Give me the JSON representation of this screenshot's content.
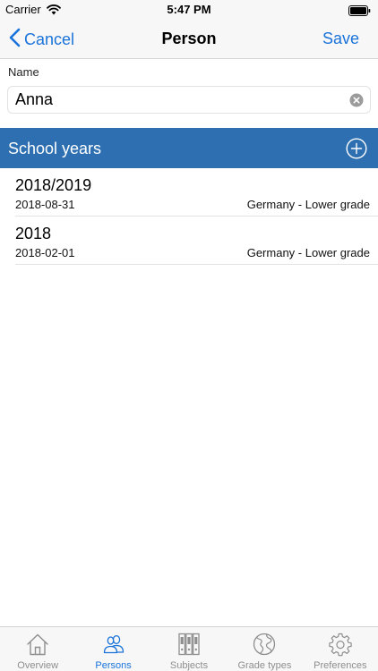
{
  "status_bar": {
    "carrier": "Carrier",
    "time": "5:47 PM"
  },
  "nav": {
    "back_label": "Cancel",
    "title": "Person",
    "save_label": "Save"
  },
  "form": {
    "name_label": "Name",
    "name_value": "Anna"
  },
  "section": {
    "title": "School years"
  },
  "school_years": [
    {
      "year": "2018/2019",
      "date": "2018-08-31",
      "grade": "Germany - Lower grade"
    },
    {
      "year": "2018",
      "date": "2018-02-01",
      "grade": "Germany - Lower grade"
    }
  ],
  "tabs": [
    {
      "label": "Overview",
      "icon": "house-icon",
      "active": false
    },
    {
      "label": "Persons",
      "icon": "persons-icon",
      "active": true
    },
    {
      "label": "Subjects",
      "icon": "binders-icon",
      "active": false
    },
    {
      "label": "Grade types",
      "icon": "globe-icon",
      "active": false
    },
    {
      "label": "Preferences",
      "icon": "gear-icon",
      "active": false
    }
  ],
  "colors": {
    "accent": "#1a73d9",
    "section_header": "#2d6fb0",
    "inactive_tab": "#8e8e8e"
  }
}
